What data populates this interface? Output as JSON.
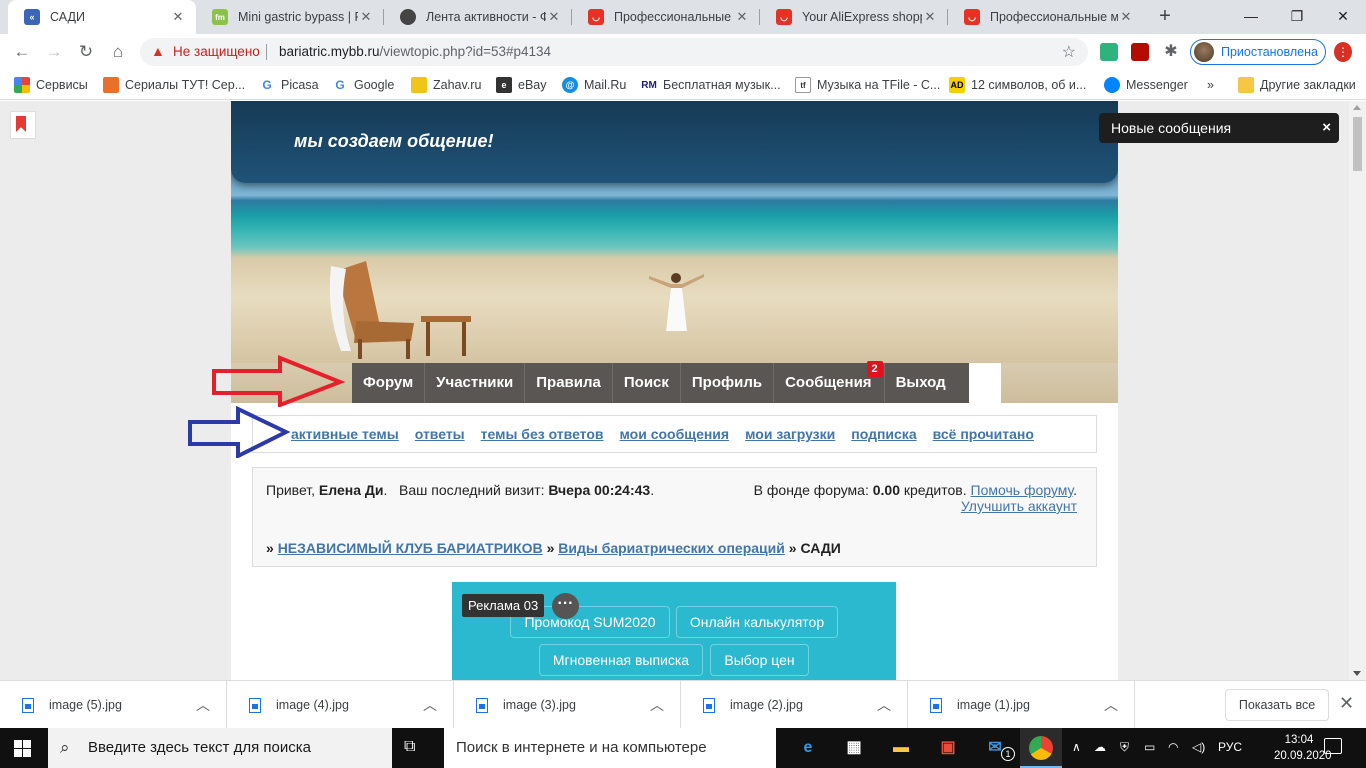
{
  "browser": {
    "tabs": [
      {
        "title": "САДИ",
        "active": true,
        "favicon": "mybb-icon"
      },
      {
        "title": "Mini gastric bypass | Fit",
        "favicon": "fitmania-icon"
      },
      {
        "title": "Лента активности - Фо",
        "favicon": "forum-avatar-icon"
      },
      {
        "title": "Профессиональные ма",
        "favicon": "aliexpress-icon"
      },
      {
        "title": "Your AliExpress shoppir",
        "favicon": "aliexpress-icon"
      },
      {
        "title": "Профессиональные ма",
        "favicon": "aliexpress-icon"
      }
    ],
    "security_label": "Не защищено",
    "url_host": "bariatric.mybb.ru",
    "url_path": "/viewtopic.php?id=53#p4134",
    "profile_label": "Приостановлена",
    "bookmarks": [
      {
        "label": "Сервисы",
        "icon": "apps-grid-icon"
      },
      {
        "label": "Сериалы ТУТ! Сер...",
        "icon": "fox-icon"
      },
      {
        "label": "Picasa",
        "icon": "google-icon"
      },
      {
        "label": "Google",
        "icon": "google-icon"
      },
      {
        "label": "Zahav.ru",
        "icon": "zahav-icon"
      },
      {
        "label": "eBay",
        "icon": "ebay-icon"
      },
      {
        "label": "Mail.Ru",
        "icon": "mailru-icon"
      },
      {
        "label": "Бесплатная музык...",
        "icon": "rm-icon"
      },
      {
        "label": "Музыка на TFile - С...",
        "icon": "tfile-icon"
      },
      {
        "label": "12 символов, об и...",
        "icon": "ad-icon"
      },
      {
        "label": "Messenger",
        "icon": "messenger-icon"
      }
    ],
    "bookmarks_more": "»",
    "other_bookmarks": "Другие закладки"
  },
  "forum": {
    "slogan": "мы создаем общение!",
    "nav": [
      "Форум",
      "Участники",
      "Правила",
      "Поиск",
      "Профиль",
      "Сообщения",
      "Выход"
    ],
    "messages_badge": "2",
    "subnav": [
      "активные темы",
      "ответы",
      "темы без ответов",
      "мои сообщения",
      "мои загрузки",
      "подписка",
      "всё прочитано"
    ],
    "greeting_prefix": "Привет,",
    "user_name": "Елена Ди",
    "last_visit_label": "Ваш последний визит:",
    "last_visit_value": "Вчера 00:24:43",
    "fund_label": "В фонде форума:",
    "fund_value": "0.00",
    "fund_unit": "кредитов.",
    "help_link": "Помочь форуму",
    "upgrade_link": "Улучшить аккаунт",
    "breadcrumb": [
      "НЕЗАВИСИМЫЙ КЛУБ БАРИАТРИКОВ",
      "Виды бариатрических операций",
      "САДИ"
    ],
    "breadcrumb_sep": "»"
  },
  "ad": {
    "label": "Реклама 03",
    "buttons": [
      "Промокод SUM2020",
      "Онлайн калькулятор",
      "Мгновенная выписка",
      "Выбор цен"
    ]
  },
  "toast": {
    "text": "Новые сообщения",
    "close": "×"
  },
  "downloads": {
    "files": [
      "image (5).jpg",
      "image (4).jpg",
      "image (3).jpg",
      "image (2).jpg",
      "image (1).jpg"
    ],
    "show_all": "Показать все"
  },
  "taskbar": {
    "search_placeholder": "Введите здесь текст для поиска",
    "web_search": "Поиск в интернете и на компьютере",
    "mail_badge": "1",
    "lang": "РУС",
    "time": "13:04",
    "date": "20.09.2020"
  },
  "colors": {
    "link": "#4276a9",
    "nav_bg": "#5a5653",
    "ad_bg": "#2ab9cf",
    "badge": "#e0121b"
  }
}
